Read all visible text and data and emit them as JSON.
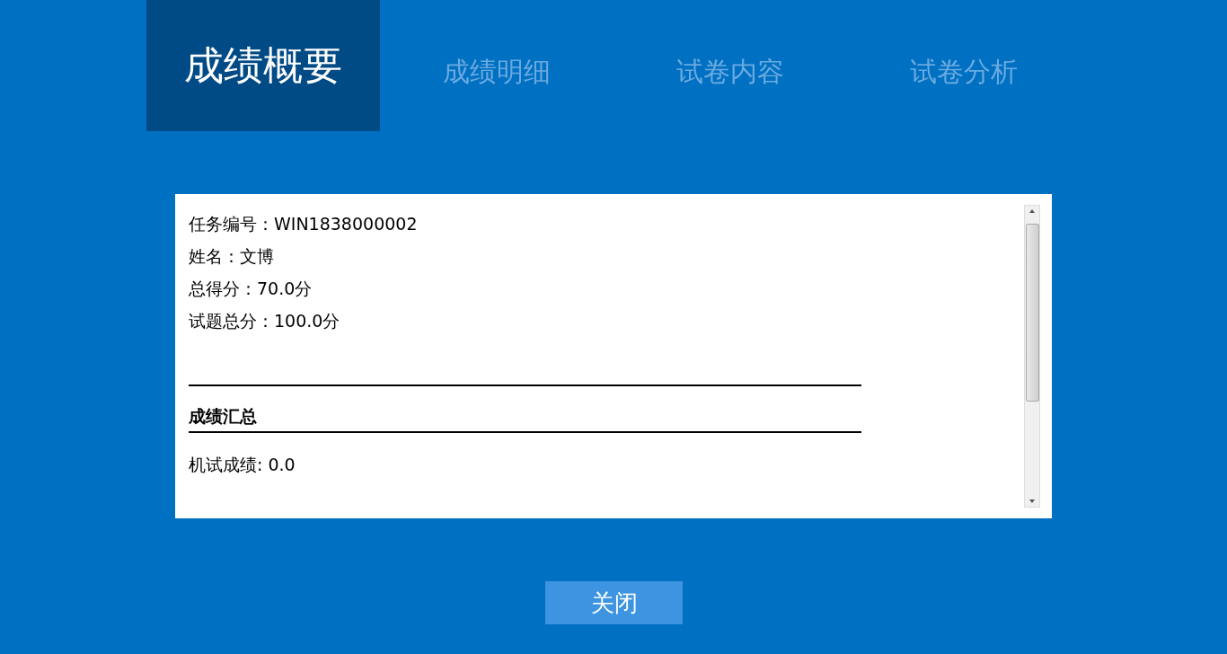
{
  "tabs": [
    {
      "label": "成绩概要",
      "selected": true
    },
    {
      "label": "成绩明细",
      "selected": false
    },
    {
      "label": "试卷内容",
      "selected": false
    },
    {
      "label": "试卷分析",
      "selected": false
    }
  ],
  "report": {
    "fields": [
      "任务编号：WIN1838000002",
      "姓名：文博",
      "总得分：70.0分",
      "试题总分：100.0分"
    ],
    "section_title": "成绩汇总",
    "section_lines": [
      "机试成绩: 0.0"
    ]
  },
  "close_button": "关闭"
}
